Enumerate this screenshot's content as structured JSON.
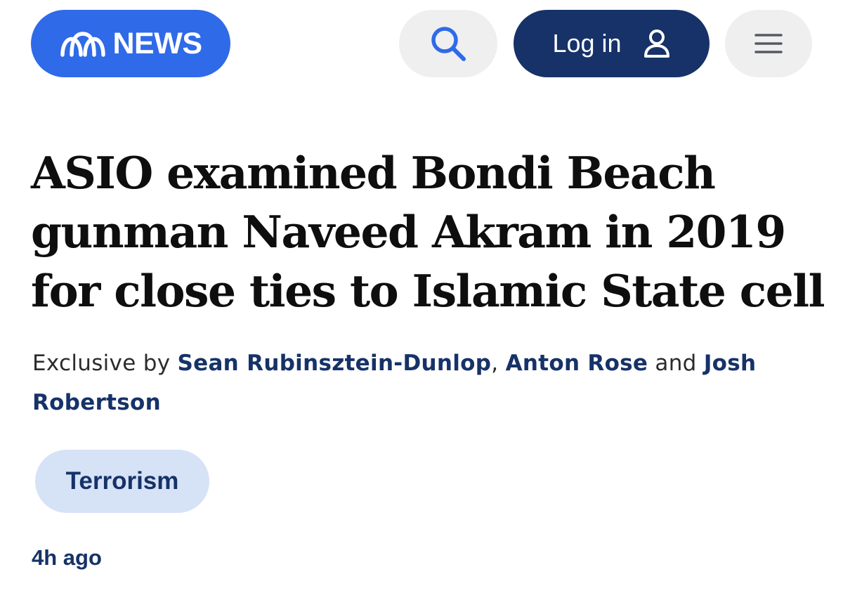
{
  "header": {
    "brand": "NEWS",
    "login_label": "Log in"
  },
  "article": {
    "headline": "ASIO examined Bondi Beach gunman Naveed Akram in 2019 for close ties to Islamic State cell",
    "byline": {
      "prefix": "Exclusive by",
      "authors": [
        "Sean Rubinsztein-Dunlop",
        "Anton Rose",
        "Josh Robertson"
      ],
      "separator": ",",
      "conjunction": "and"
    },
    "tag": "Terrorism",
    "timestamp": "4h ago"
  },
  "icons": {
    "logo": "abc-logo-icon",
    "search": "search-icon",
    "user": "user-icon",
    "menu": "hamburger-menu-icon"
  },
  "colors": {
    "brand_blue": "#2f6ae8",
    "navy": "#163268",
    "pill_grey": "#efeff0",
    "tag_bg": "#d6e2f6"
  }
}
